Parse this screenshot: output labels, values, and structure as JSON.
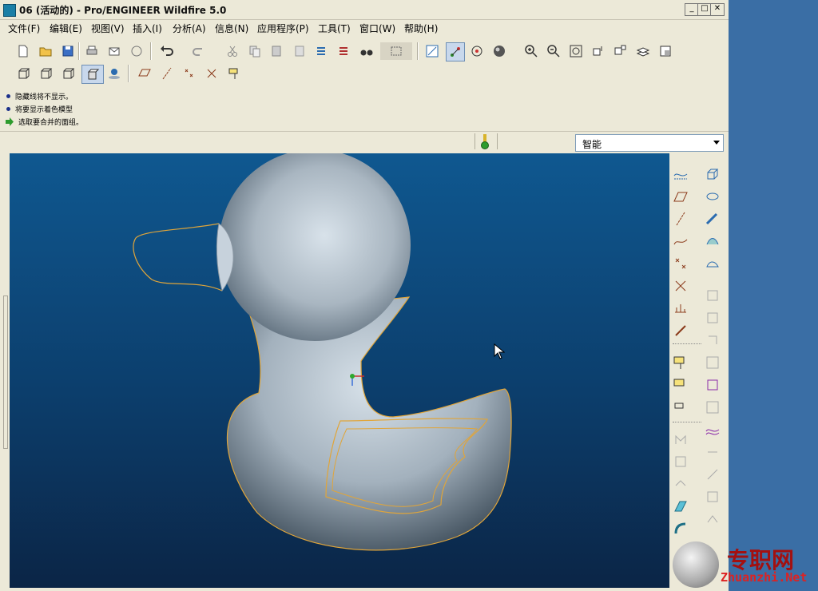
{
  "window": {
    "title": "06 (活动的) - Pro/ENGINEER Wildfire 5.0"
  },
  "window_controls": {
    "minimize": "_",
    "maximize": "□",
    "close": "✕"
  },
  "menu": [
    "文件(F)",
    "编辑(E)",
    "视图(V)",
    "插入(I)",
    "分析(A)",
    "信息(N)",
    "应用程序(P)",
    "工具(T)",
    "窗口(W)",
    "帮助(H)"
  ],
  "messages": [
    {
      "text": "隐藏线将不显示。",
      "icon": "bullet"
    },
    {
      "text": "将要显示着色模型",
      "icon": "bullet"
    },
    {
      "text": "选取要合并的面组。",
      "icon": "green-arrow"
    }
  ],
  "filter": {
    "selected": "智能"
  },
  "watermark": {
    "brand": "专职网",
    "url": "Zhuanzhi.Net"
  },
  "colors": {
    "viewport_top": "#0f5890",
    "viewport_bottom": "#0b2546",
    "edge_highlight": "#e5a83a",
    "window_bg": "#ece9d8"
  }
}
